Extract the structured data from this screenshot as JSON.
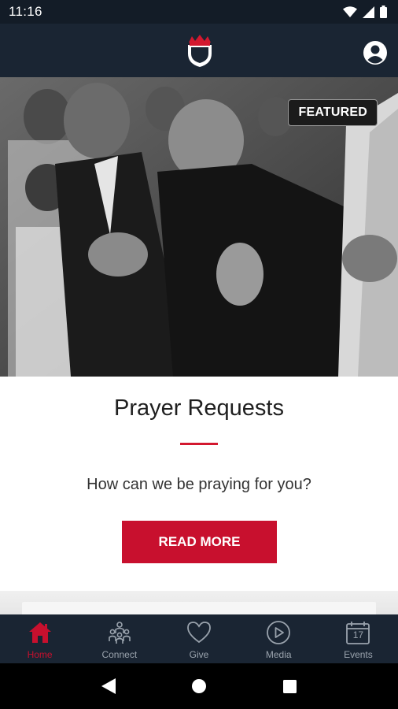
{
  "status_bar": {
    "time": "11:16"
  },
  "header": {
    "logo_icon": "crown-shield-logo-icon",
    "profile_icon": "account-circle-icon"
  },
  "hero": {
    "badge": "FEATURED",
    "image": "people-praying-photo"
  },
  "card": {
    "title": "Prayer Requests",
    "subtitle": "How can we be praying for you?",
    "button_label": "READ MORE"
  },
  "tabs": [
    {
      "label": "Home",
      "icon": "home-icon",
      "active": true
    },
    {
      "label": "Connect",
      "icon": "people-icon",
      "active": false
    },
    {
      "label": "Give",
      "icon": "heart-icon",
      "active": false
    },
    {
      "label": "Media",
      "icon": "play-icon",
      "active": false
    },
    {
      "label": "Events",
      "icon": "calendar-icon",
      "active": false,
      "calendar_day": "17"
    }
  ],
  "colors": {
    "accent": "#c8102e",
    "header_bg": "#1a2533",
    "tab_inactive": "#9aa3ad"
  }
}
